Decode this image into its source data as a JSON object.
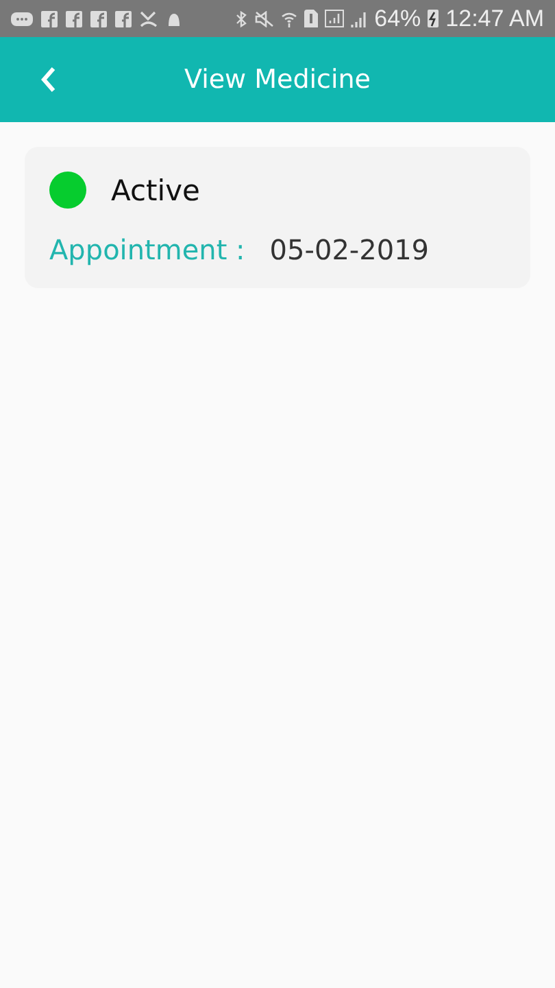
{
  "status_bar": {
    "battery": "64%",
    "time": "12:47 AM"
  },
  "app_bar": {
    "title": "View Medicine"
  },
  "card": {
    "status": {
      "label": "Active",
      "color": "#06cc2e"
    },
    "appointment": {
      "label": "Appointment :",
      "value": "05-02-2019"
    }
  }
}
